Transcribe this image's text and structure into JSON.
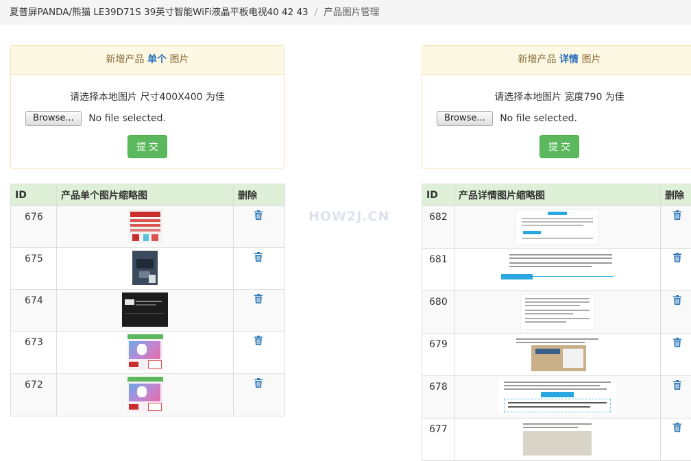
{
  "breadcrumb": {
    "product": "夏普屏PANDA/熊猫 LE39D71S 39英寸智能WiFi液晶平板电视40 42 43",
    "separator": "/",
    "current": "产品图片管理"
  },
  "single_panel": {
    "heading_prefix": "新增产品",
    "heading_em": "单个",
    "heading_suffix": "图片",
    "tip": "请选择本地图片 尺寸400X400 为佳",
    "browse_label": "Browse...",
    "file_status": "No file selected.",
    "submit_label": "提交"
  },
  "detail_panel": {
    "heading_prefix": "新增产品",
    "heading_em": "详情",
    "heading_suffix": "图片",
    "tip": "请选择本地图片 宽度790 为佳",
    "browse_label": "Browse...",
    "file_status": "No file selected.",
    "submit_label": "提交"
  },
  "single_table": {
    "headers": [
      "ID",
      "产品单个图片缩略图",
      "删除"
    ],
    "rows": [
      {
        "id": "676"
      },
      {
        "id": "675"
      },
      {
        "id": "674"
      },
      {
        "id": "673"
      },
      {
        "id": "672"
      }
    ]
  },
  "detail_table": {
    "headers": [
      "ID",
      "产品详情图片缩略图",
      "删除"
    ],
    "rows": [
      {
        "id": "682"
      },
      {
        "id": "681"
      },
      {
        "id": "680"
      },
      {
        "id": "679"
      },
      {
        "id": "678"
      },
      {
        "id": "677"
      }
    ]
  },
  "watermark": "HOW2J.CN",
  "colors": {
    "breadcrumb_bg": "#f5f5f5",
    "panel_heading_bg": "#fcf8e3",
    "panel_heading_text": "#8a6d3b",
    "heading_em": "#2a6ebb",
    "submit_green": "#5cb85c",
    "table_header_bg": "#dff0d8",
    "trash_blue": "#337ab7"
  },
  "icons": {
    "delete": "trash-icon"
  }
}
